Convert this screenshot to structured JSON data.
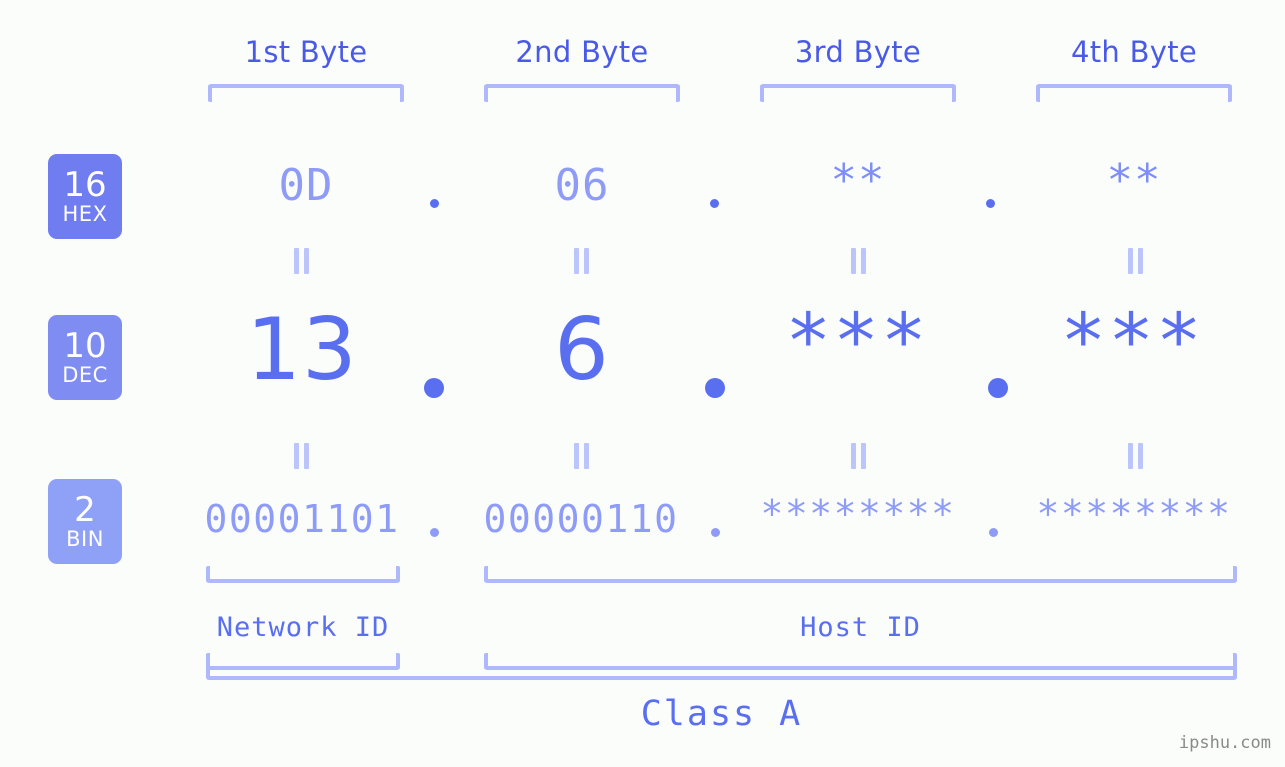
{
  "meta": {
    "background_color": "#fbfdfa",
    "accent_color": "#5a6ef0",
    "muted_accent_color": "#8f9cf7",
    "bracket_color": "#aeb8fb",
    "badge_color_hex": "#6f7df0",
    "badge_color_dec": "#7f8df2",
    "badge_color_bin": "#8fa1f6",
    "watermark": "ipshu.com"
  },
  "byte_headers": [
    {
      "label": "1st Byte"
    },
    {
      "label": "2nd Byte"
    },
    {
      "label": "3rd Byte"
    },
    {
      "label": "4th Byte"
    }
  ],
  "bases": [
    {
      "number": "16",
      "abbr": "HEX"
    },
    {
      "number": "10",
      "abbr": "DEC"
    },
    {
      "number": "2",
      "abbr": "BIN"
    }
  ],
  "rows": {
    "hex": {
      "base_number": "16",
      "base_abbr": "HEX",
      "values": [
        "0D",
        "06",
        "**",
        "**"
      ],
      "separator": "."
    },
    "dec": {
      "base_number": "10",
      "base_abbr": "DEC",
      "values": [
        "13",
        "6",
        "***",
        "***"
      ],
      "separator": "."
    },
    "bin": {
      "base_number": "2",
      "base_abbr": "BIN",
      "values": [
        "00001101",
        "00000110",
        "********",
        "********"
      ],
      "separator": "."
    }
  },
  "equal_marks": {
    "symbol": "=",
    "count_per_row": 4
  },
  "segments": {
    "network_id": "Network ID",
    "host_id": "Host ID",
    "class": "Class A"
  }
}
